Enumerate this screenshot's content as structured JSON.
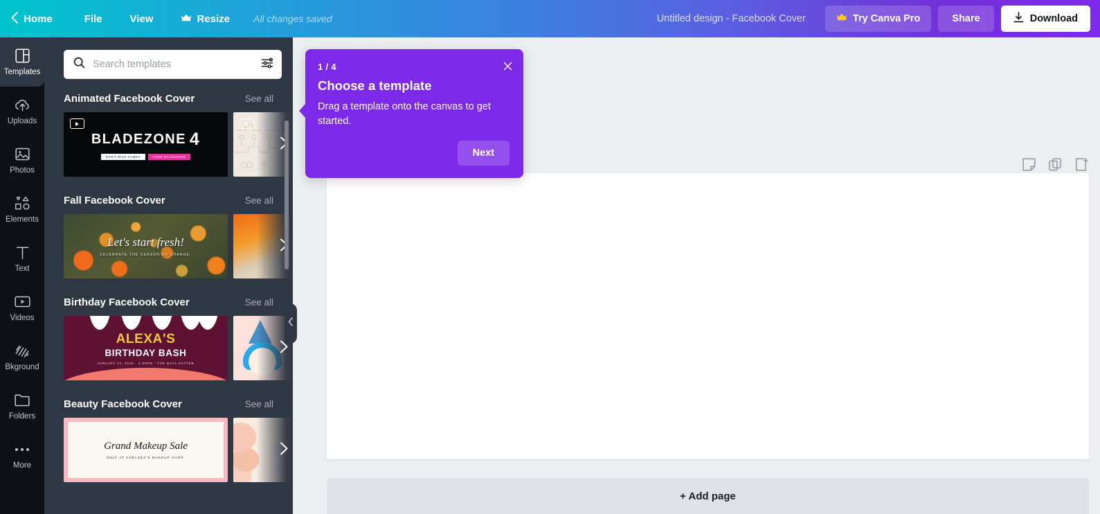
{
  "topbar": {
    "back_icon": "chevron-left-icon",
    "home": "Home",
    "file": "File",
    "view": "View",
    "resize_icon": "crown-icon",
    "resize": "Resize",
    "saved_status": "All changes saved",
    "doc_title": "Untitled design - Facebook Cover",
    "pro_icon": "crown-icon",
    "pro": "Try Canva Pro",
    "share": "Share",
    "download_icon": "download-icon",
    "download": "Download",
    "gradient_start": "#00c4cc",
    "gradient_end": "#7d2ae8"
  },
  "rail": {
    "items": [
      {
        "label": "Templates",
        "icon": "templates-icon",
        "active": true
      },
      {
        "label": "Uploads",
        "icon": "upload-cloud-icon",
        "active": false
      },
      {
        "label": "Photos",
        "icon": "image-icon",
        "active": false
      },
      {
        "label": "Elements",
        "icon": "shapes-icon",
        "active": false
      },
      {
        "label": "Text",
        "icon": "text-t-icon",
        "active": false
      },
      {
        "label": "Videos",
        "icon": "video-icon",
        "active": false
      },
      {
        "label": "Bkground",
        "icon": "hatch-pattern-icon",
        "active": false
      },
      {
        "label": "Folders",
        "icon": "folder-icon",
        "active": false
      },
      {
        "label": "More",
        "icon": "ellipsis-icon",
        "active": false
      }
    ]
  },
  "panel": {
    "search": {
      "placeholder": "Search templates",
      "value": "",
      "search_icon": "search-icon",
      "filter_icon": "filter-sliders-icon"
    },
    "see_all_label": "See all",
    "sections": [
      {
        "title": "Animated Facebook Cover",
        "see_all": "See all",
        "thumb": {
          "kind": "animated",
          "title": "BLADEZONE",
          "number": "4",
          "pill_left": "DON'T MISS GAMES",
          "pill_right": "COME BLADEZONE"
        }
      },
      {
        "title": "Fall Facebook Cover",
        "see_all": "See all",
        "thumb": {
          "kind": "fall",
          "title": "Let's start fresh!",
          "subtitle": "CELEBRATE THE SEASON OF CHANGE."
        }
      },
      {
        "title": "Birthday Facebook Cover",
        "see_all": "See all",
        "thumb": {
          "kind": "birthday",
          "line1": "ALEXA'S",
          "line2": "BIRTHDAY BASH",
          "line3": "JANUARY 12, 2019  ·  2:00PM  ·  THE MAYA HATTER"
        }
      },
      {
        "title": "Beauty Facebook Cover",
        "see_all": "See all",
        "thumb": {
          "kind": "beauty",
          "title": "Grand Makeup Sale",
          "subtitle": "ONLY AT CHELSEA'S MAKEUP SHOP."
        }
      }
    ],
    "collapse_icon": "chevron-left-icon"
  },
  "canvas": {
    "tools": [
      {
        "icon": "notes-icon"
      },
      {
        "icon": "duplicate-page-icon"
      },
      {
        "icon": "add-page-icon"
      }
    ],
    "add_page_label": "+ Add page"
  },
  "tooltip": {
    "step": "1 / 4",
    "title": "Choose a template",
    "body": "Drag a template onto the canvas to get started.",
    "next": "Next",
    "close_icon": "close-icon",
    "color": "#7d2ae8"
  }
}
